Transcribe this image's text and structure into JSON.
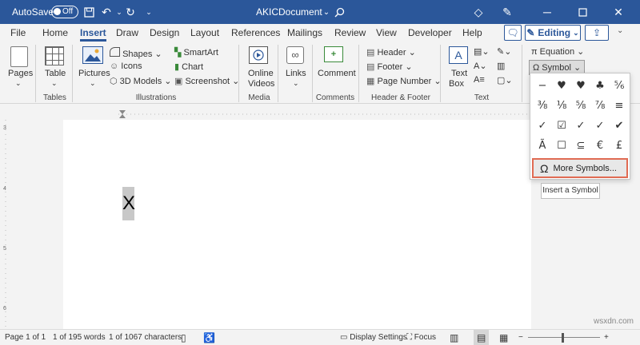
{
  "title_bar": {
    "autosave_label": "AutoSave",
    "autosave_state": "Off",
    "doc_name": "AKICDocument",
    "icons": [
      "save-icon",
      "undo-icon",
      "redo-icon",
      "search-icon",
      "premium-icon",
      "pen-icon",
      "minimize-icon",
      "restore-icon",
      "close-icon"
    ]
  },
  "tabs": [
    "File",
    "Home",
    "Insert",
    "Draw",
    "Design",
    "Layout",
    "References",
    "Mailings",
    "Review",
    "View",
    "Developer",
    "Help"
  ],
  "active_tab": "Insert",
  "editing_label": "Editing",
  "ribbon": {
    "pages": "Pages",
    "table": "Table",
    "pictures": "Pictures",
    "shapes": "Shapes",
    "icons": "Icons",
    "models": "3D Models",
    "smartart": "SmartArt",
    "chart": "Chart",
    "screenshot": "Screenshot",
    "online_videos_1": "Online",
    "online_videos_2": "Videos",
    "links": "Links",
    "comment": "Comment",
    "header": "Header",
    "footer": "Footer",
    "page_number": "Page Number",
    "textbox_1": "Text",
    "textbox_2": "Box",
    "equation": "Equation",
    "symbol": "Symbol",
    "groups": {
      "tables": "Tables",
      "illustrations": "Illustrations",
      "media": "Media",
      "comments": "Comments",
      "header_footer": "Header & Footer",
      "text": "Text"
    }
  },
  "document": {
    "selected_text": "X"
  },
  "symbol_menu": {
    "symbols": [
      "−",
      "♥",
      "♥",
      "♣",
      "⅚",
      "⅜",
      "⅛",
      "⅝",
      "⅞",
      "≡",
      "✓",
      "☑",
      "✓",
      "✓",
      "✔",
      "Ã",
      "☐",
      "⊆",
      "€",
      "£"
    ],
    "more_symbols": "More Symbols...",
    "tooltip": "Insert a Symbol"
  },
  "status_bar": {
    "page": "Page 1 of 1",
    "words": "1 of 195 words",
    "characters": "1 of 1067 characters",
    "display_settings": "Display Settings",
    "focus": "Focus"
  },
  "watermark": "wsxdn.com",
  "colors": {
    "accent": "#2b579a",
    "highlight_border": "#e06b53"
  }
}
